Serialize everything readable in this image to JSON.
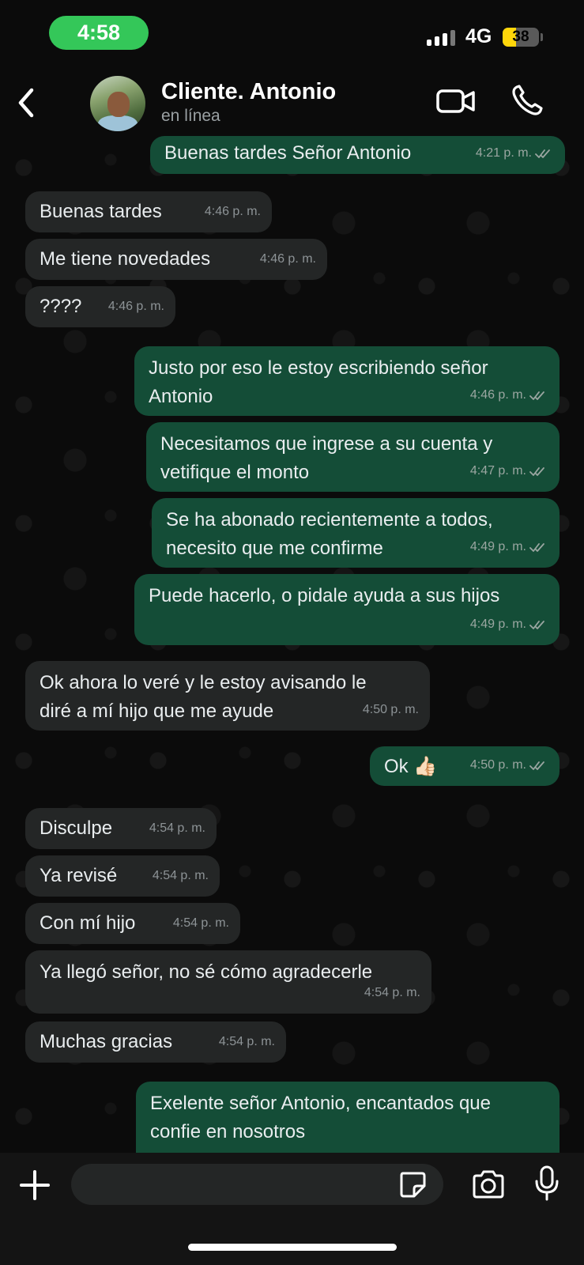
{
  "status_bar": {
    "time": "4:58",
    "network": "4G",
    "battery": "38",
    "battery_level": 0.38
  },
  "header": {
    "contact_name": "Cliente. Antonio",
    "contact_status": "en línea"
  },
  "messages": [
    {
      "dir": "out",
      "lines": [
        "Buenas tardes Señor Antonio"
      ],
      "time": "4:21 p. m."
    },
    {
      "dir": "in",
      "lines": [
        "Buenas tardes"
      ],
      "time": "4:46 p. m."
    },
    {
      "dir": "in",
      "lines": [
        "Me tiene novedades"
      ],
      "time": "4:46 p. m."
    },
    {
      "dir": "in",
      "lines": [
        "????"
      ],
      "time": "4:46 p. m."
    },
    {
      "dir": "out",
      "lines": [
        "Justo por eso le estoy escribiendo señor",
        "Antonio"
      ],
      "time": "4:46 p. m."
    },
    {
      "dir": "out",
      "lines": [
        "Necesitamos que ingrese a su cuenta y",
        "vetifique el monto"
      ],
      "time": "4:47 p. m."
    },
    {
      "dir": "out",
      "lines": [
        "Se ha abonado recientemente a todos,",
        "necesito que me confirme"
      ],
      "time": "4:49 p. m."
    },
    {
      "dir": "out",
      "lines": [
        "Puede hacerlo, o pidale ayuda a sus hijos"
      ],
      "time": "4:49 p. m."
    },
    {
      "dir": "in",
      "lines": [
        "Ok ahora lo veré y le estoy avisando le",
        "diré a mí hijo que me ayude"
      ],
      "time": "4:50 p. m."
    },
    {
      "dir": "out",
      "lines": [
        "Ok 👍🏻"
      ],
      "time": "4:50 p. m."
    },
    {
      "dir": "in",
      "lines": [
        "Disculpe"
      ],
      "time": "4:54 p. m."
    },
    {
      "dir": "in",
      "lines": [
        "Ya revisé"
      ],
      "time": "4:54 p. m."
    },
    {
      "dir": "in",
      "lines": [
        "Con mí hijo"
      ],
      "time": "4:54 p. m."
    },
    {
      "dir": "in",
      "lines": [
        "Ya llegó señor, no sé cómo agradecerle"
      ],
      "time": "4:54 p. m."
    },
    {
      "dir": "in",
      "lines": [
        "Muchas gracias"
      ],
      "time": "4:54 p. m."
    },
    {
      "dir": "out",
      "lines": [
        "Exelente señor Antonio, encantados que",
        "confie en nosotros"
      ],
      "time": ""
    }
  ],
  "composer": {
    "placeholder": ""
  },
  "icons": {
    "back": "chevron-left-icon",
    "video": "video-call-icon",
    "phone": "phone-call-icon",
    "plus": "plus-icon",
    "sticker": "sticker-icon",
    "camera": "camera-icon",
    "mic": "microphone-icon",
    "ticks": "double-check-icon"
  },
  "colors": {
    "incoming_bubble": "#242626",
    "outgoing_bubble": "#144d37",
    "time_pill": "#34c759",
    "battery": "#ffd60a"
  }
}
